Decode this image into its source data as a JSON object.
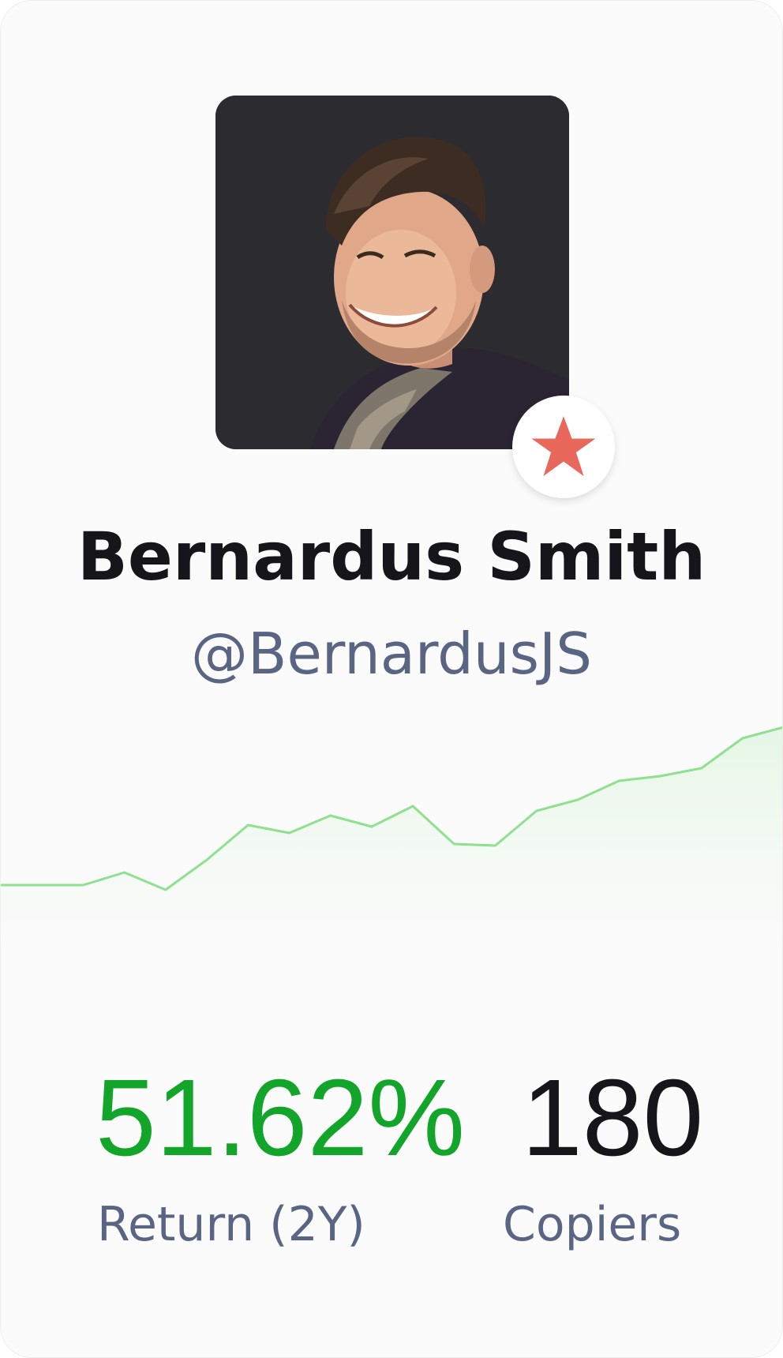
{
  "profile": {
    "name": "Bernardus Smith",
    "handle": "@BernardusJS",
    "avatar_icon": "profile-photo",
    "badge_icon": "star-icon",
    "badge_color": "#e8695b"
  },
  "stats": {
    "return_value": "51.62%",
    "return_label": "Return (2Y)",
    "copiers_value": "180",
    "copiers_label": "Copiers"
  },
  "colors": {
    "positive": "#12a52a",
    "line": "#8fe08f",
    "muted_text": "#5a6583"
  },
  "chart_data": {
    "type": "area",
    "x": [
      0,
      1,
      2,
      3,
      4,
      5,
      6,
      7,
      8,
      9,
      10,
      11,
      12,
      13,
      14,
      15,
      16,
      17,
      18,
      19
    ],
    "values": [
      0.0,
      0.0,
      0.0,
      0.8,
      -0.3,
      1.6,
      3.8,
      3.3,
      4.4,
      3.7,
      5.0,
      2.6,
      2.5,
      4.7,
      5.4,
      6.6,
      6.9,
      7.4,
      9.3,
      10.0
    ],
    "title": "",
    "xlabel": "",
    "ylabel": "",
    "grid": false,
    "legend": "none"
  }
}
